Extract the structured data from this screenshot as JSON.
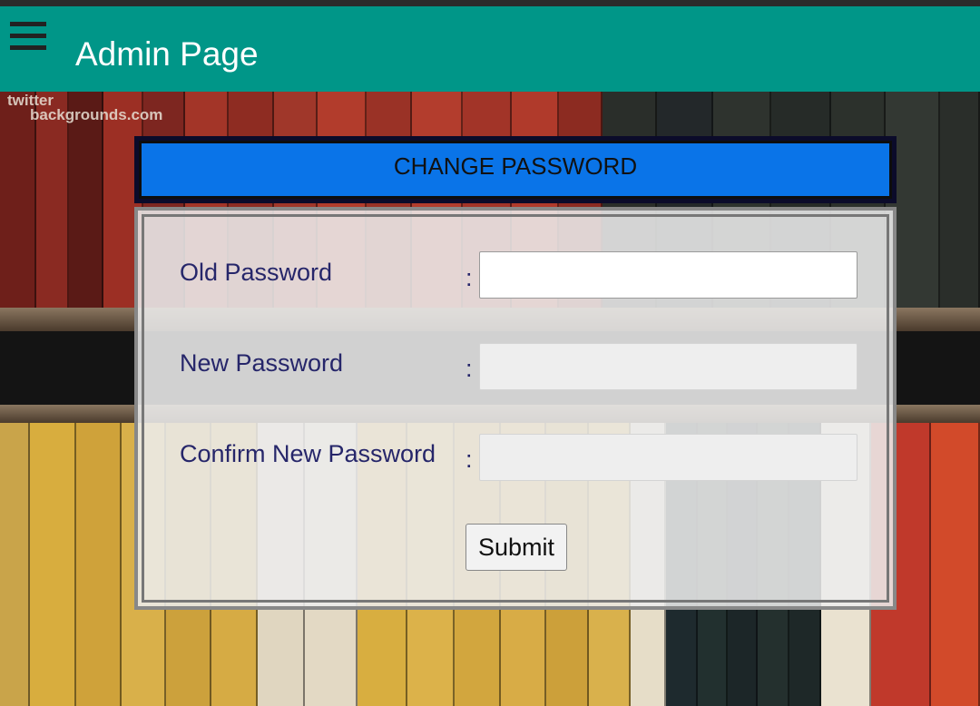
{
  "app_bar": {
    "title": "Admin Page",
    "menu_icon": "hamburger-menu-icon",
    "color": "#009688"
  },
  "background": {
    "watermark_line1": "twitter",
    "watermark_line2": "backgrounds.com"
  },
  "panel": {
    "title": "CHANGE PASSWORD",
    "header_color": "#0a74e8"
  },
  "form": {
    "old_password": {
      "label": "Old Password",
      "separator": ":",
      "value": ""
    },
    "new_password": {
      "label": "New Password",
      "separator": ":",
      "value": ""
    },
    "confirm_password": {
      "label": "Confirm New Password",
      "separator": ":",
      "value": ""
    },
    "submit_label": "Submit"
  }
}
